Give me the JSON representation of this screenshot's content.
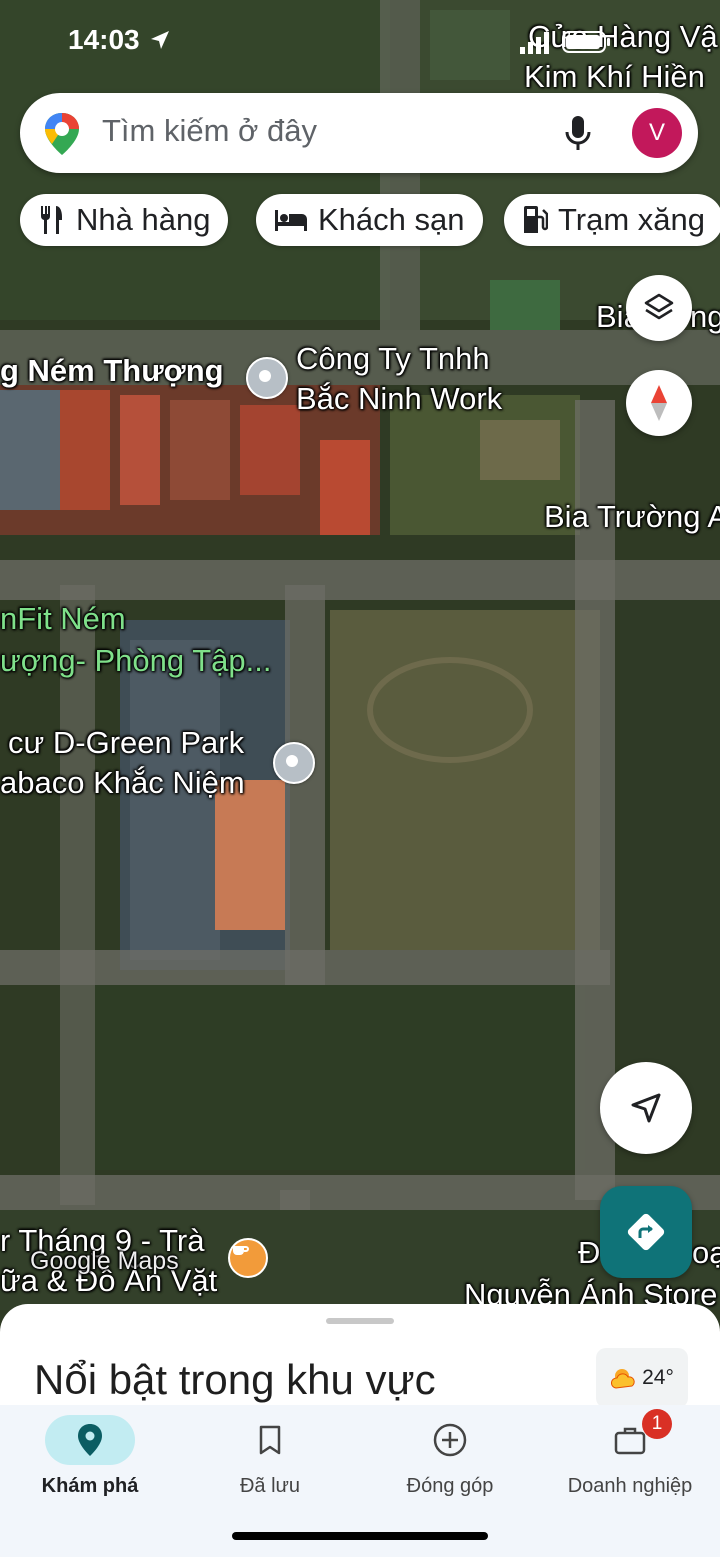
{
  "status_bar": {
    "time": "14:03"
  },
  "search": {
    "placeholder": "Tìm kiếm ở đây",
    "avatar_letter": "V"
  },
  "chips": [
    {
      "label": "Nhà hàng",
      "icon": "fork-knife-icon"
    },
    {
      "label": "Khách sạn",
      "icon": "bed-icon"
    },
    {
      "label": "Trạm xăng",
      "icon": "gas-station-icon"
    }
  ],
  "map_labels": {
    "top_right_line1": "Cửa Hàng Vậ",
    "top_right_line2": "Kim Khí Hiền",
    "street_left": "g Ném Thượng",
    "company_line1": "Công Ty Tnhh",
    "company_line2": "Bắc Ninh Work",
    "bia_top": "Bia",
    "bia_top_suffix": "ng",
    "bia_truong": "Bia Trường A",
    "gym_line1": "nFit Ném",
    "gym_line2": "ượng- Phòng Tập...",
    "apartment_line1": "cư D-Green Park",
    "apartment_line2": "abaco Khắc Niệm",
    "cafe_line1": "r Tháng 9 - Trà",
    "cafe_line2": "ữa & Đồ Ăn Vặt",
    "google_maps": "Google Maps",
    "store_line1": "Đ",
    "store_line1_suffix": "oạ",
    "store_line2": "Nguyễn Ánh Store"
  },
  "sheet": {
    "title": "Nổi bật trong khu vực",
    "temperature": "24°"
  },
  "bottom_nav": [
    {
      "label": "Khám phá",
      "icon": "explore-pin-icon",
      "active": true
    },
    {
      "label": "Đã lưu",
      "icon": "bookmark-icon",
      "active": false
    },
    {
      "label": "Đóng góp",
      "icon": "add-circle-icon",
      "active": false
    },
    {
      "label": "Doanh nghiệp",
      "icon": "business-icon",
      "active": false,
      "badge": "1"
    }
  ]
}
